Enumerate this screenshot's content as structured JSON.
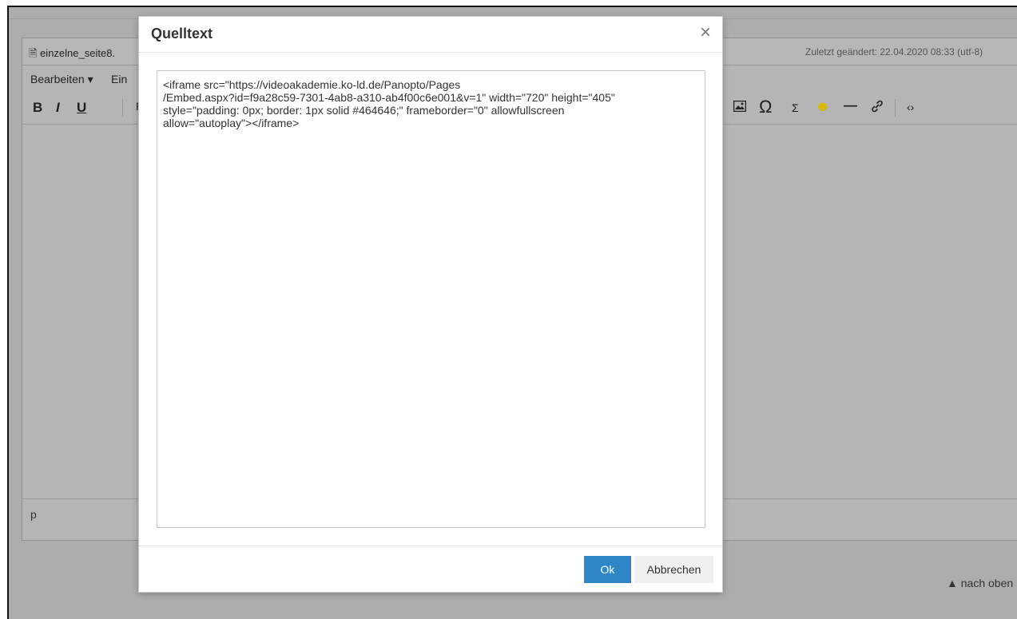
{
  "editor": {
    "file_name": "einzelne_seite8.",
    "last_modified": "Zuletzt geändert: 22.04.2020 08:33   (utf-8)",
    "menu": {
      "edit": "Bearbeiten ▾",
      "insert_partial": "Ein"
    },
    "toolbar": {
      "bold": "B",
      "italic": "I",
      "underline": "U",
      "format_partial": "F",
      "image_icon": "image-icon",
      "omega": "Ω",
      "sigma": "Σ",
      "smiley": "☻",
      "hr": "—",
      "link": "🔗",
      "code": "‹›"
    },
    "status_path": "p",
    "back_to_top": "nach oben"
  },
  "dialog": {
    "title": "Quelltext",
    "close": "×",
    "source_code": "<iframe src=\"https://videoakademie.ko-ld.de/Panopto/Pages\n/Embed.aspx?id=f9a28c59-7301-4ab8-a310-ab4f00c6e001&v=1\" width=\"720\" height=\"405\"\nstyle=\"padding: 0px; border: 1px solid #464646;\" frameborder=\"0\" allowfullscreen\nallow=\"autoplay\"></iframe>",
    "ok_label": "Ok",
    "cancel_label": "Abbrechen"
  },
  "colors": {
    "overlay": "#adadad",
    "ok": "#2f86c6"
  }
}
